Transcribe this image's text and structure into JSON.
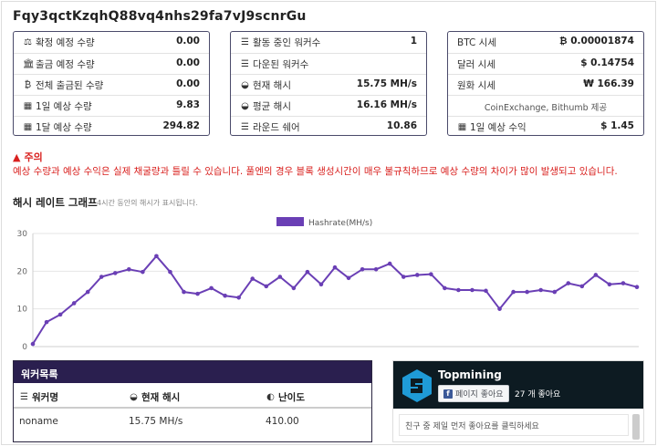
{
  "page": {
    "title": "Fqy3qctKzqhQ88vq4nhs29fa7vJ9scnrGu"
  },
  "earnings_card": {
    "rows": [
      {
        "icon": "balance-icon",
        "label": "확정 예정 수량",
        "value": "0.00"
      },
      {
        "icon": "bank-icon",
        "label": "출금 예정 수량",
        "value": "0.00"
      },
      {
        "icon": "bitcoin-icon",
        "label": "전체 출금된 수량",
        "value": "0.00"
      },
      {
        "icon": "calculator-icon",
        "label": "1일 예상 수량",
        "value": "9.83"
      },
      {
        "icon": "calculator-icon",
        "label": "1달 예상 수량",
        "value": "294.82"
      }
    ]
  },
  "workers_card": {
    "rows": [
      {
        "icon": "server-icon",
        "label": "활동 중인 워커수",
        "value": "1"
      },
      {
        "icon": "server-icon",
        "label": "다운된 워커수",
        "value": ""
      },
      {
        "icon": "gauge-icon",
        "label": "현재 해시",
        "value": "15.75 MH/s"
      },
      {
        "icon": "gauge-icon",
        "label": "평균 해시",
        "value": "16.16 MH/s"
      },
      {
        "icon": "server-icon",
        "label": "라운드 쉐어",
        "value": "10.86"
      }
    ]
  },
  "price_card": {
    "rows": [
      {
        "label": "BTC 시세",
        "value": "0.00001874",
        "symbol": "₿"
      },
      {
        "label": "달러 시세",
        "value": "0.14754",
        "symbol": "$"
      },
      {
        "label": "원화 시세",
        "value": "166.39",
        "symbol": "₩"
      }
    ],
    "source_note": "CoinExchange, Bithumb 제공",
    "daily": {
      "icon": "calculator-icon",
      "label": "1일 예상 수익",
      "value": "$ 1.45"
    }
  },
  "warning": {
    "heading": "주의",
    "text": "예상 수량과 예상 수익은 실제 채굴량과 틀릴 수 있습니다. 풀엔의 경우 블록 생성시간이 매우 불규칙하므로 예상 수량의 차이가 많이 발생되고 있습니다."
  },
  "graph": {
    "title": "해시 레이트 그래프",
    "subtitle": "4시간 동안의 해시가 표시됩니다."
  },
  "chart_data": {
    "type": "line",
    "title": "",
    "xlabel": "",
    "ylabel": "",
    "ylim": [
      0,
      30
    ],
    "yticks": [
      "0",
      "10",
      "20",
      "30"
    ],
    "grid": true,
    "legend": "top-center",
    "color": "#6a3fb5",
    "series": [
      {
        "name": "Hashrate(MH/s)",
        "values": [
          0.7,
          6.5,
          8.5,
          11.5,
          14.5,
          18.5,
          19.5,
          20.5,
          19.8,
          24,
          19.8,
          14.5,
          14,
          15.5,
          13.5,
          13,
          18,
          16,
          18.5,
          15.5,
          19.8,
          16.5,
          21,
          18.2,
          20.5,
          20.5,
          22,
          18.5,
          19,
          19.2,
          15.5,
          15,
          15,
          14.8,
          10,
          14.5,
          14.5,
          15,
          14.5,
          16.8,
          16,
          19,
          16.5,
          16.8,
          15.8
        ]
      }
    ]
  },
  "worker_list": {
    "title": "워커목록",
    "headers": [
      {
        "icon": "server-icon",
        "label": "워커명"
      },
      {
        "icon": "gauge-icon",
        "label": "현재 해시"
      },
      {
        "icon": "shield-icon",
        "label": "난이도"
      }
    ],
    "rows": [
      [
        "noname",
        "15.75 MH/s",
        "410.00"
      ]
    ]
  },
  "facebook": {
    "page_name": "Topmining",
    "like_label": "페이지 좋아요",
    "like_count": "27 개 좋아요",
    "comment_placeholder": "친구 중 제일 먼저 좋아요를 클릭하세요"
  }
}
